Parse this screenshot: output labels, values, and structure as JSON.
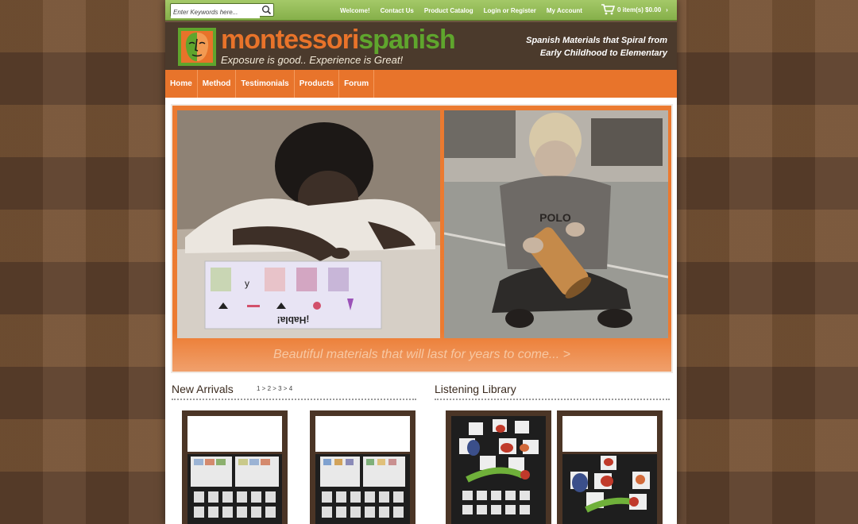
{
  "search": {
    "placeholder": "Enter Keywords here..."
  },
  "top_links": [
    "Welcome!",
    "Contact Us",
    "Product Catalog",
    "Login or Register",
    "My Account"
  ],
  "cart": {
    "text": "0 item(s) $0.00"
  },
  "brand": {
    "name_part1": "montessori",
    "name_part2": "spanish",
    "tagline": "Exposure is good.. Experience is Great!",
    "right_line1": "Spanish Materials that Spiral from",
    "right_line2": "Early Childhood to Elementary",
    "color_orange": "#e8732a",
    "color_green": "#5fa52d"
  },
  "nav": [
    "Home",
    "Method",
    "Testimonials",
    "Products",
    "Forum"
  ],
  "banner": {
    "caption": "Beautiful materials that will last for years to come... >",
    "card_text": "¡Habla!",
    "shirt_text": "POLO"
  },
  "sections": {
    "new_arrivals": {
      "title": "New Arrivals",
      "pager": "1 > 2 > 3 > 4"
    },
    "listening_library": {
      "title": "Listening Library"
    }
  }
}
